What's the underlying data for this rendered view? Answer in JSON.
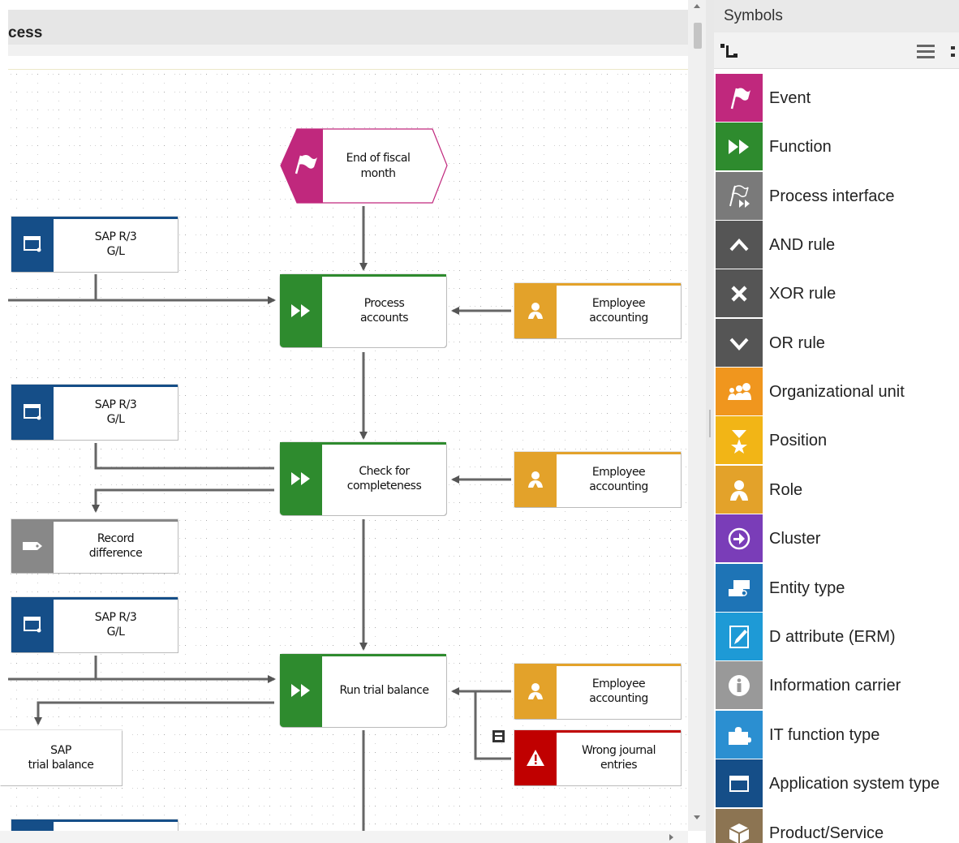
{
  "model": {
    "title": "cess"
  },
  "diagram": {
    "nodes": {
      "event_end_fiscal": "End of fiscal\nmonth",
      "sap_1": "SAP R/3\nG/L",
      "func_process": "Process\naccounts",
      "role_1": "Employee\naccounting",
      "sap_2": "SAP R/3\nG/L",
      "func_check": "Check for\ncompleteness",
      "role_2": "Employee\naccounting",
      "record_diff": "Record\ndifference",
      "sap_3": "SAP R/3\nG/L",
      "func_trial": "Run trial balance",
      "role_3": "Employee\naccounting",
      "sap_trial": "SAP\ntrial balance",
      "risk_wrong": "Wrong journal\nentries"
    }
  },
  "symbols_panel": {
    "title": "Symbols",
    "items": [
      {
        "label": "Event",
        "color": "#c0287d",
        "icon": "flag-icon"
      },
      {
        "label": "Function",
        "color": "#2e8b2e",
        "icon": "fast-forward-icon"
      },
      {
        "label": "Process interface",
        "color": "#7a7a7a",
        "icon": "flag-forward-icon"
      },
      {
        "label": "AND rule",
        "color": "#555555",
        "icon": "caret-up-icon"
      },
      {
        "label": "XOR rule",
        "color": "#555555",
        "icon": "x-icon"
      },
      {
        "label": "OR rule",
        "color": "#555555",
        "icon": "caret-down-icon"
      },
      {
        "label": "Organizational unit",
        "color": "#f0961e",
        "icon": "group-icon"
      },
      {
        "label": "Position",
        "color": "#f2b516",
        "icon": "position-icon"
      },
      {
        "label": "Role",
        "color": "#e3a22a",
        "icon": "person-icon"
      },
      {
        "label": "Cluster",
        "color": "#7a3db8",
        "icon": "cluster-icon"
      },
      {
        "label": "Entity type",
        "color": "#1e74b6",
        "icon": "entity-icon"
      },
      {
        "label": "D attribute (ERM)",
        "color": "#1e9ad6",
        "icon": "pen-icon"
      },
      {
        "label": "Information carrier",
        "color": "#999999",
        "icon": "info-icon"
      },
      {
        "label": "IT function type",
        "color": "#2b8fd1",
        "icon": "puzzle-icon"
      },
      {
        "label": "Application system type",
        "color": "#154e88",
        "icon": "window-icon"
      },
      {
        "label": "Product/Service",
        "color": "#8c7452",
        "icon": "box-icon"
      }
    ]
  }
}
